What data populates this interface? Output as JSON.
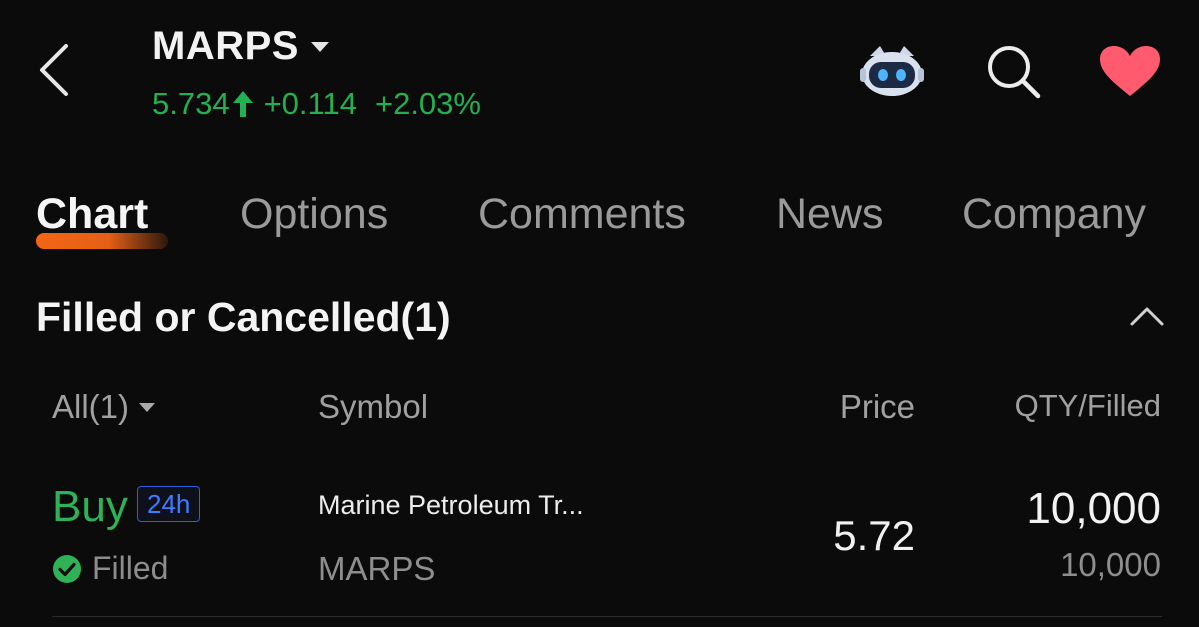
{
  "header": {
    "ticker": "MARPS",
    "price": "5.734",
    "change": "+0.114",
    "change_pct": "+2.03%",
    "up_color": "#22b052",
    "icons": [
      "back-icon",
      "robot-assistant-icon",
      "search-icon",
      "heart-icon"
    ]
  },
  "tabs": [
    {
      "label": "Chart",
      "active": true
    },
    {
      "label": "Options",
      "active": false
    },
    {
      "label": "Comments",
      "active": false
    },
    {
      "label": "News",
      "active": false
    },
    {
      "label": "Company",
      "active": false
    }
  ],
  "accent_color": "#ff6a14",
  "section": {
    "title": "Filled or Cancelled(1)"
  },
  "table": {
    "headers": {
      "filter": "All(1)",
      "symbol": "Symbol",
      "price": "Price",
      "qty": "QTY/Filled"
    },
    "rows": [
      {
        "side": "Buy",
        "session": "24h",
        "status": "Filled",
        "name": "Marine Petroleum Tr...",
        "symbol": "MARPS",
        "price": "5.72",
        "qty": "10,000",
        "filled": "10,000"
      }
    ]
  }
}
